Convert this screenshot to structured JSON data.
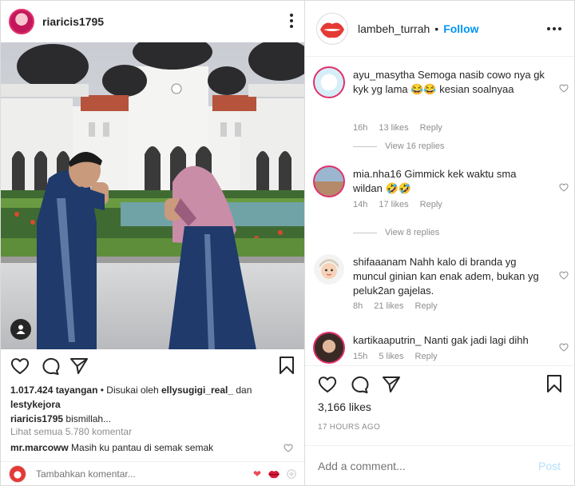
{
  "left_post": {
    "username": "riaricis1795",
    "views": "1.017.424 tayangan",
    "liked_by_prefix": " • Disukai oleh ",
    "liked_by_user1": "ellysugigi_real_",
    "liked_by_and": " dan",
    "liked_by_user2": "lestykejora",
    "caption_user": "riaricis1795",
    "caption_text": " bismillah...",
    "view_all_comments": "Lihat semua 5.780 komentar",
    "comment_user": "mr.marcoww",
    "comment_text": " Masih ku pantau di semak semak",
    "add_comment_placeholder": "Tambahkan komentar...",
    "icons": [
      "more-vertical-icon",
      "user-tag-icon",
      "heart-icon",
      "comment-icon",
      "share-icon",
      "bookmark-icon",
      "heart-emoji-icon",
      "lips-emoji-icon",
      "add-icon"
    ]
  },
  "right_post": {
    "username": "lambeh_turrah",
    "separator": "•",
    "follow_label": "Follow",
    "comments": [
      {
        "user": "ayu_masytha",
        "text": " Semoga nasib cowo nya gk kyk yg lama 😂😂 kesian soalnyaa",
        "time": "16h",
        "likes": "13 likes",
        "reply": "Reply",
        "view_replies": "View 16 replies"
      },
      {
        "user": "mia.nha16",
        "text": " Gimmick kek waktu sma wildan 🤣🤣",
        "time": "14h",
        "likes": "17 likes",
        "reply": "Reply",
        "view_replies": "View 8 replies"
      },
      {
        "user": "shifaaanam",
        "text": " Nahh kalo di branda yg muncul ginian kan enak adem, bukan yg peluk2an gajelas.",
        "time": "8h",
        "likes": "21 likes",
        "reply": "Reply"
      },
      {
        "user": "kartikaaputrin_",
        "text": " Nanti gak jadi lagi dihh",
        "time": "15h",
        "likes": "5 likes",
        "reply": "Reply"
      }
    ],
    "likes": "3,166 likes",
    "posted_time": "17 HOURS AGO",
    "add_comment_placeholder": "Add a comment...",
    "post_label": "Post"
  },
  "colors": {
    "link_blue": "#0095f6",
    "post_disabled": "#b2dffc",
    "muted": "#8e8e8e",
    "text": "#262626",
    "heart_red": "#ed4956",
    "story_ring": "#e1306c"
  }
}
